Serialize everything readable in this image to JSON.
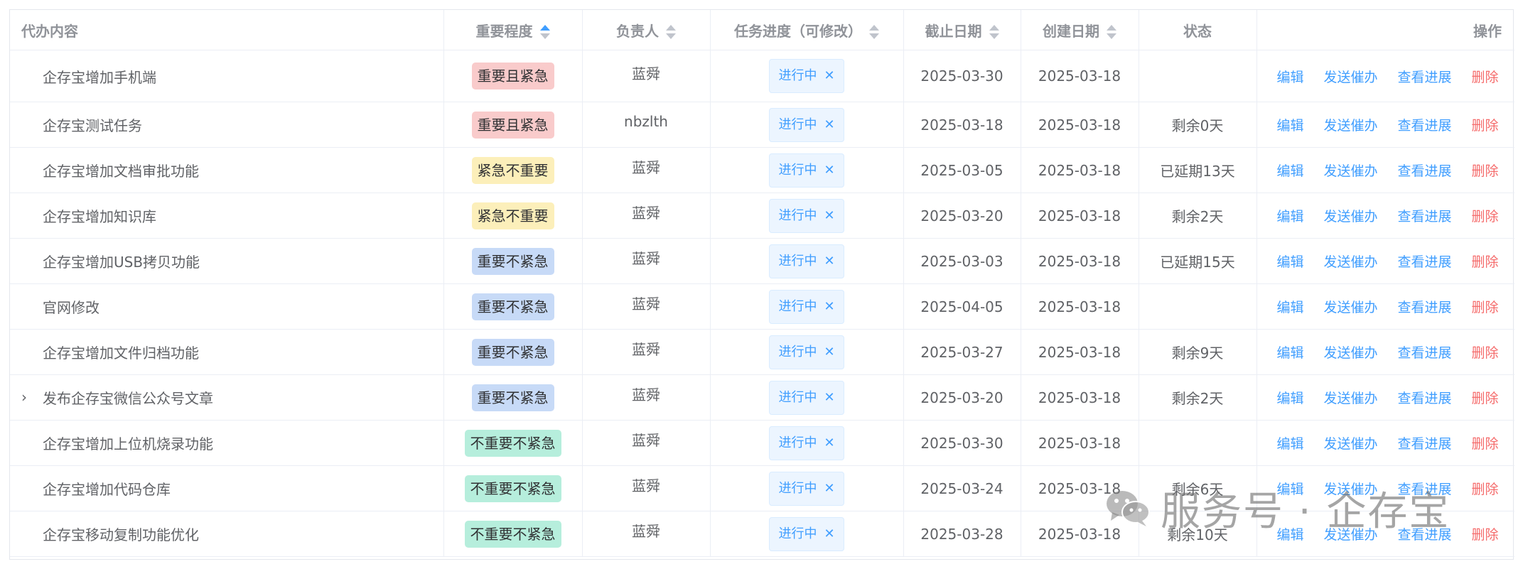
{
  "headers": {
    "content": "代办内容",
    "importance": "重要程度",
    "owner": "负责人",
    "progress": "任务进度（可修改）",
    "deadline": "截止日期",
    "created": "创建日期",
    "status": "状态",
    "actions": "操作"
  },
  "actions": {
    "edit": "编辑",
    "remind": "发送催办",
    "view": "查看进展",
    "delete": "删除"
  },
  "priority_colors": {
    "重要且紧急": "#f9cbcb",
    "紧急不重要": "#fcefba",
    "重要不紧急": "#c7daf7",
    "不重要不紧急": "#b6eedc"
  },
  "rows": [
    {
      "content": "企存宝增加手机端",
      "priority": "重要且紧急",
      "owner": "蓝舜",
      "progress": "进行中",
      "deadline": "2025-03-30",
      "created": "2025-03-18",
      "status": ""
    },
    {
      "content": "企存宝测试任务",
      "priority": "重要且紧急",
      "owner": "nbzlth",
      "progress": "进行中",
      "deadline": "2025-03-18",
      "created": "2025-03-18",
      "status": "剩余0天"
    },
    {
      "content": "企存宝增加文档审批功能",
      "priority": "紧急不重要",
      "owner": "蓝舜",
      "progress": "进行中",
      "deadline": "2025-03-05",
      "created": "2025-03-18",
      "status": "已延期13天"
    },
    {
      "content": "企存宝增加知识库",
      "priority": "紧急不重要",
      "owner": "蓝舜",
      "progress": "进行中",
      "deadline": "2025-03-20",
      "created": "2025-03-18",
      "status": "剩余2天"
    },
    {
      "content": "企存宝增加USB拷贝功能",
      "priority": "重要不紧急",
      "owner": "蓝舜",
      "progress": "进行中",
      "deadline": "2025-03-03",
      "created": "2025-03-18",
      "status": "已延期15天"
    },
    {
      "content": "官网修改",
      "priority": "重要不紧急",
      "owner": "蓝舜",
      "progress": "进行中",
      "deadline": "2025-04-05",
      "created": "2025-03-18",
      "status": ""
    },
    {
      "content": "企存宝增加文件归档功能",
      "priority": "重要不紧急",
      "owner": "蓝舜",
      "progress": "进行中",
      "deadline": "2025-03-27",
      "created": "2025-03-18",
      "status": "剩余9天"
    },
    {
      "content": "发布企存宝微信公众号文章",
      "priority": "重要不紧急",
      "owner": "蓝舜",
      "progress": "进行中",
      "deadline": "2025-03-20",
      "created": "2025-03-18",
      "status": "剩余2天",
      "expandable": true
    },
    {
      "content": "企存宝增加上位机烧录功能",
      "priority": "不重要不紧急",
      "owner": "蓝舜",
      "progress": "进行中",
      "deadline": "2025-03-30",
      "created": "2025-03-18",
      "status": ""
    },
    {
      "content": "企存宝增加代码仓库",
      "priority": "不重要不紧急",
      "owner": "蓝舜",
      "progress": "进行中",
      "deadline": "2025-03-24",
      "created": "2025-03-18",
      "status": "剩余6天"
    },
    {
      "content": "企存宝移动复制功能优化",
      "priority": "不重要不紧急",
      "owner": "蓝舜",
      "progress": "进行中",
      "deadline": "2025-03-28",
      "created": "2025-03-18",
      "status": "剩余10天"
    }
  ],
  "watermark": {
    "text": "服务号 · 企存宝",
    "icon": "wechat-icon"
  }
}
